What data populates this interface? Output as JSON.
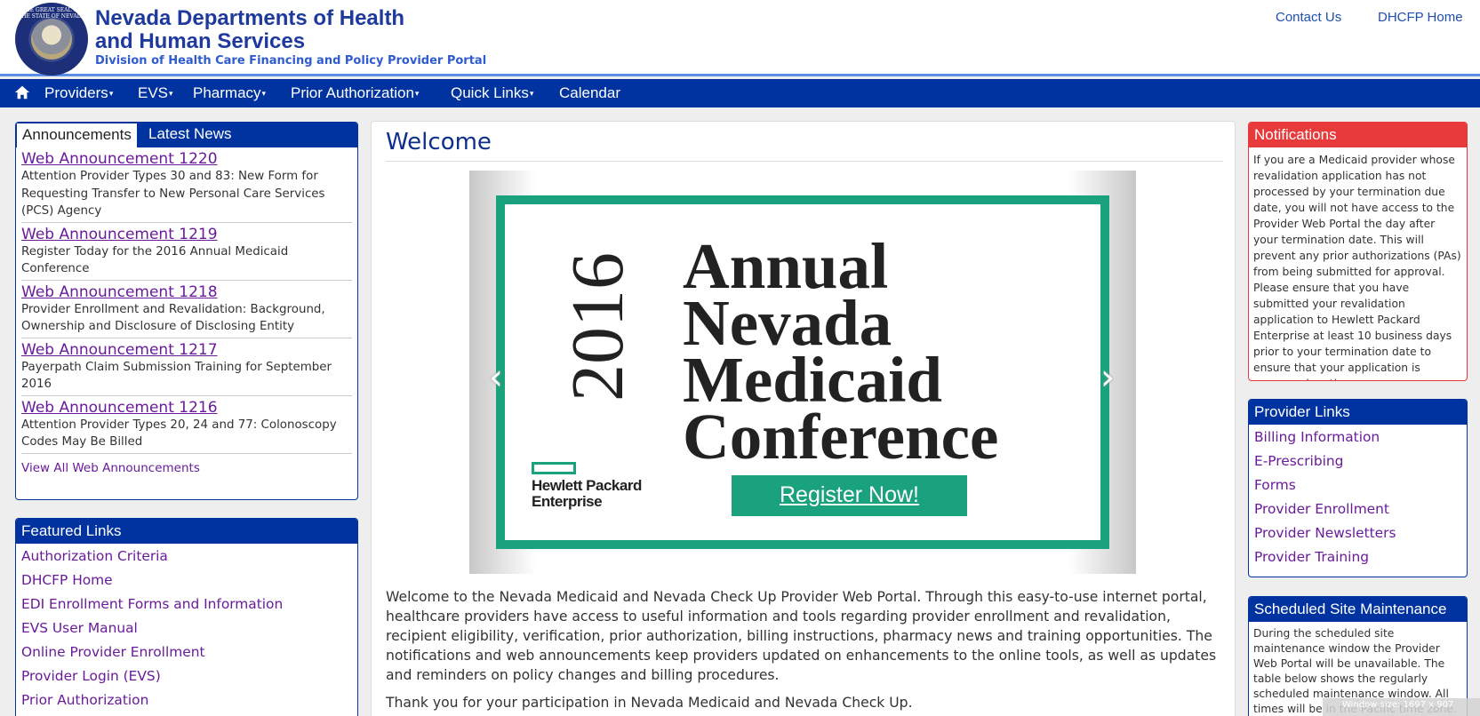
{
  "header": {
    "seal_text": "THE GREAT SEAL OF THE STATE OF NEVADA",
    "title": "Nevada Departments of Health and Human Services",
    "subtitle": "Division of Health Care Financing and Policy Provider Portal",
    "contact": "Contact Us",
    "dhcfp_home": "DHCFP Home"
  },
  "nav": {
    "items": [
      "Providers",
      "EVS",
      "Pharmacy",
      "Prior Authorization",
      "Quick Links",
      "Calendar"
    ],
    "caret": "▾"
  },
  "announcements": {
    "tabs": [
      "Announcements",
      "Latest News"
    ],
    "items": [
      {
        "title": "Web Announcement 1220",
        "desc": "Attention Provider Types 30 and 83: New Form for Requesting Transfer to New Personal Care Services (PCS) Agency"
      },
      {
        "title": "Web Announcement 1219",
        "desc": "Register Today for the 2016 Annual Medicaid Conference"
      },
      {
        "title": "Web Announcement 1218",
        "desc": "Provider Enrollment and Revalidation: Background, Ownership and Disclosure of Disclosing Entity"
      },
      {
        "title": "Web Announcement 1217",
        "desc": "Payerpath Claim Submission Training for September 2016"
      },
      {
        "title": "Web Announcement 1216",
        "desc": "Attention Provider Types 20, 24 and 77: Colonoscopy Codes May Be Billed"
      }
    ],
    "view_all": "View All Web Announcements"
  },
  "featured": {
    "title": "Featured Links",
    "links": [
      "Authorization Criteria",
      "DHCFP Home",
      "EDI Enrollment Forms and Information",
      "EVS User Manual",
      "Online Provider Enrollment",
      "Provider Login (EVS)",
      "Prior Authorization"
    ]
  },
  "main": {
    "title": "Welcome",
    "banner": {
      "year": "2016",
      "line1": "Annual",
      "line2": "Nevada",
      "line3": "Medicaid",
      "line4": "Conference",
      "hpe1": "Hewlett Packard",
      "hpe2": "Enterprise",
      "register": "Register Now!",
      "prev": "‹",
      "next": "›"
    },
    "intro": "Welcome to the Nevada Medicaid and Nevada Check Up Provider Web Portal. Through this easy-to-use internet portal, healthcare providers have access to useful information and tools regarding provider enrollment and revalidation, recipient eligibility, verification, prior authorization, billing instructions, pharmacy news and training opportunities. The notifications and web announcements keep providers updated on enhancements to the online tools, as well as updates and reminders on policy changes and billing procedures.",
    "thanks": "Thank you for your participation in Nevada Medicaid and Nevada Check Up."
  },
  "notifications": {
    "title": "Notifications",
    "body": "If you are a Medicaid provider whose revalidation application has not processed by your termination due date, you will not have access to the Provider Web Portal the day after your termination date. This will prevent any prior authorizations (PAs) from being submitted for approval. Please ensure that you have submitted your revalidation application to Hewlett Packard Enterprise at least 10 business days prior to your termination date to ensure that your application is processed on time."
  },
  "provider_links": {
    "title": "Provider Links",
    "links": [
      "Billing Information",
      "E-Prescribing",
      "Forms",
      "Provider Enrollment",
      "Provider Newsletters",
      "Provider Training"
    ]
  },
  "maintenance": {
    "title": "Scheduled Site Maintenance",
    "body": "During the scheduled site maintenance window the Provider Web Portal will be unavailable. The table below shows the regularly scheduled maintenance window. All times will be in the Pacific time zone."
  },
  "overlay": {
    "window_size": "Window size: 1697 x 907"
  },
  "colors": {
    "nav_blue": "#0033a0",
    "notification_red": "#e83a3a",
    "banner_green": "#1aa17d",
    "link_purple": "#6a1b9a"
  }
}
